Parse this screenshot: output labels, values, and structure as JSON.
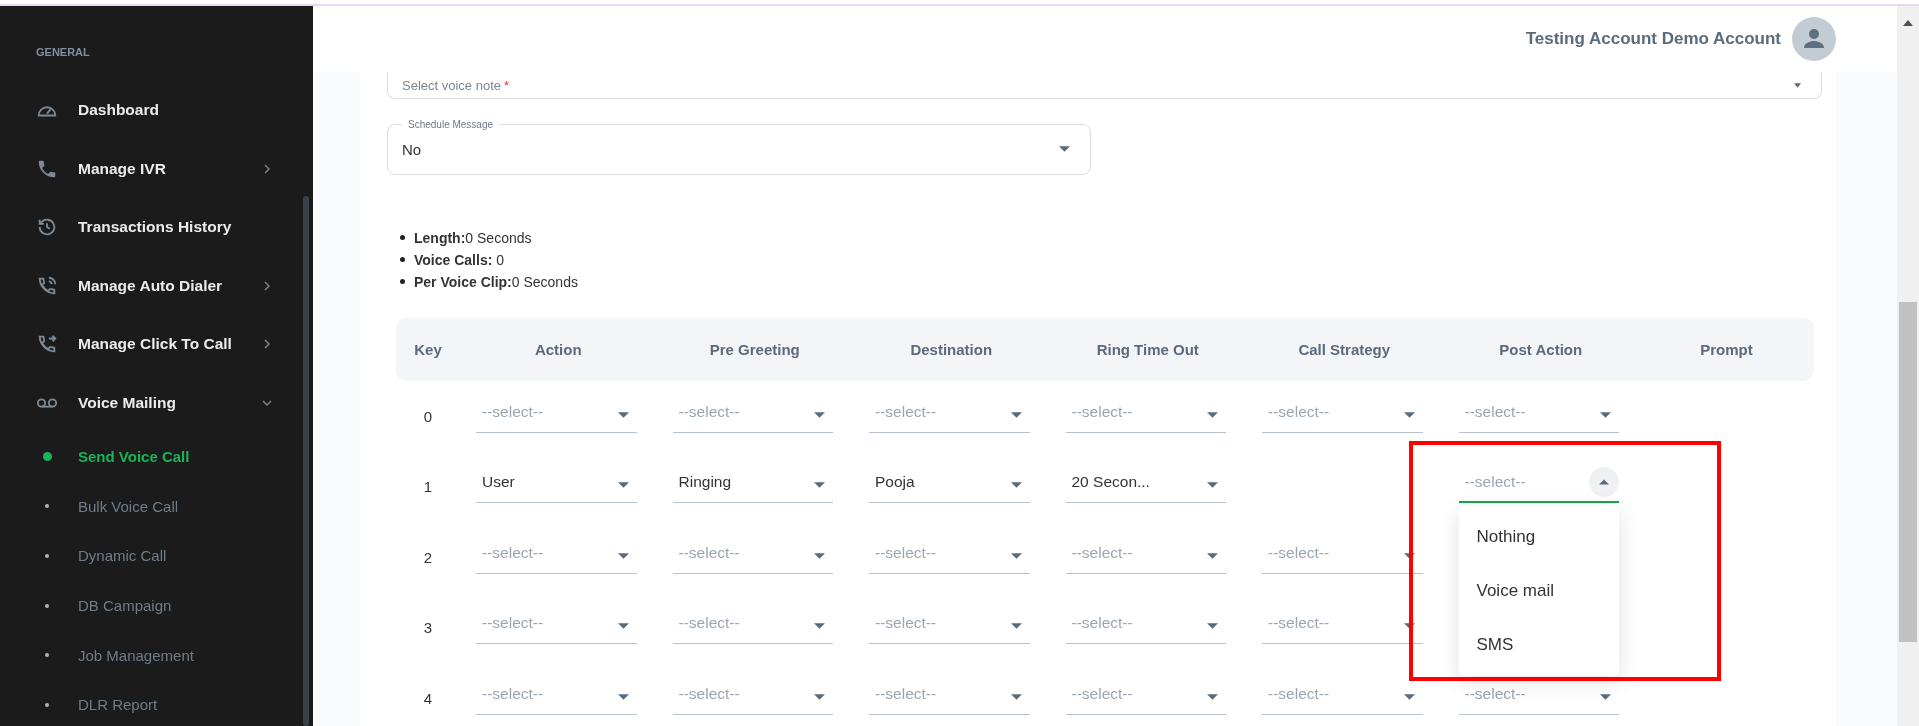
{
  "top_bar": {
    "account_name": "Testing Account Demo Account"
  },
  "sidebar": {
    "section": "GENERAL",
    "items": [
      {
        "label": "Dashboard",
        "has_submenu": false
      },
      {
        "label": "Manage IVR",
        "has_submenu": true
      },
      {
        "label": "Transactions History",
        "has_submenu": false
      },
      {
        "label": "Manage Auto Dialer",
        "has_submenu": true
      },
      {
        "label": "Manage Click To Call",
        "has_submenu": true
      },
      {
        "label": "Voice Mailing",
        "has_submenu": true,
        "expanded": true,
        "children": [
          {
            "label": "Send Voice Call",
            "selected": true
          },
          {
            "label": "Bulk Voice Call",
            "selected": false
          },
          {
            "label": "Dynamic Call",
            "selected": false
          },
          {
            "label": "DB Campaign",
            "selected": false
          },
          {
            "label": "Job Management",
            "selected": false
          },
          {
            "label": "DLR Report",
            "selected": false
          }
        ]
      }
    ]
  },
  "form": {
    "voice_note": {
      "placeholder": "Select voice note",
      "required_mark": "*"
    },
    "schedule": {
      "label": "Schedule Message",
      "value": "No"
    }
  },
  "summary": [
    "**Length:**0 Seconds",
    "**Voice Calls:** 0",
    "**Per Voice Clip:**0 Seconds"
  ],
  "table": {
    "columns": [
      "Key",
      "Action",
      "Pre Greeting",
      "Destination",
      "Ring Time Out",
      "Call Strategy",
      "Post Action",
      "Prompt"
    ],
    "rows": [
      {
        "key": "0",
        "cells": [
          {
            "kind": "select",
            "placeholder": "--select--",
            "open": false
          },
          {
            "kind": "select",
            "placeholder": "--select--",
            "open": false
          },
          {
            "kind": "select",
            "placeholder": "--select--",
            "open": false
          },
          {
            "kind": "select",
            "placeholder": "--select--",
            "open": false
          },
          {
            "kind": "select",
            "placeholder": "--select--",
            "open": false
          },
          {
            "kind": "select",
            "placeholder": "--select--",
            "open": false
          }
        ]
      },
      {
        "key": "1",
        "cells": [
          {
            "kind": "select",
            "value": "User",
            "open": false
          },
          {
            "kind": "select",
            "value": "Ringing",
            "open": false
          },
          {
            "kind": "select",
            "value": "Pooja",
            "open": false
          },
          {
            "kind": "select",
            "value": "20 Secon...",
            "open": false
          },
          {
            "kind": "empty"
          },
          {
            "kind": "select",
            "placeholder": "--select--",
            "open": true,
            "highlighted": true,
            "options": [
              "Nothing",
              "Voice mail",
              "SMS"
            ]
          }
        ]
      },
      {
        "key": "2",
        "cells": [
          {
            "kind": "select",
            "placeholder": "--select--",
            "open": false
          },
          {
            "kind": "select",
            "placeholder": "--select--",
            "open": false
          },
          {
            "kind": "select",
            "placeholder": "--select--",
            "open": false
          },
          {
            "kind": "select",
            "placeholder": "--select--",
            "open": false
          },
          {
            "kind": "select",
            "placeholder": "--select--",
            "open": false
          }
        ]
      },
      {
        "key": "3",
        "cells": [
          {
            "kind": "select",
            "placeholder": "--select--",
            "open": false
          },
          {
            "kind": "select",
            "placeholder": "--select--",
            "open": false
          },
          {
            "kind": "select",
            "placeholder": "--select--",
            "open": false
          },
          {
            "kind": "select",
            "placeholder": "--select--",
            "open": false
          },
          {
            "kind": "select",
            "placeholder": "--select--",
            "open": false
          }
        ]
      },
      {
        "key": "4",
        "cells": [
          {
            "kind": "select",
            "placeholder": "--select--",
            "open": false
          },
          {
            "kind": "select",
            "placeholder": "--select--",
            "open": false
          },
          {
            "kind": "select",
            "placeholder": "--select--",
            "open": false
          },
          {
            "kind": "select",
            "placeholder": "--select--",
            "open": false
          },
          {
            "kind": "select",
            "placeholder": "--select--",
            "open": false
          },
          {
            "kind": "select",
            "placeholder": "--select--",
            "open": false
          }
        ]
      }
    ]
  }
}
